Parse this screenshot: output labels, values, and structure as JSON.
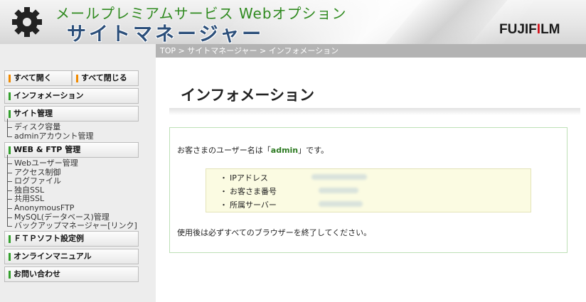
{
  "header": {
    "subtitle": "メールプレミアムサービス Webオプション",
    "title": "サイトマネージャー",
    "brand_main": "FUJIFILM",
    "brand_dot": "I"
  },
  "breadcrumb": [
    "TOP",
    "サイトマネージャー",
    "インフォメーション"
  ],
  "sidebar": {
    "expand_all": "すべて開く",
    "collapse_all": "すべて閉じる",
    "information": "インフォメーション",
    "site_admin": "サイト管理",
    "site_admin_items": [
      "ディスク容量",
      "adminアカウント管理"
    ],
    "web_ftp": "WEB & FTP 管理",
    "web_ftp_items": [
      "Webユーザー管理",
      "アクセス制御",
      "ログファイル",
      "独自SSL",
      "共用SSL",
      "AnonymousFTP",
      "MySQL(データベース)管理",
      "バックアップマネージャー[リンク]"
    ],
    "ftp_soft": "ＦＴＰソフト設定例",
    "manual": "オンラインマニュアル",
    "contact": "お問い合わせ"
  },
  "main": {
    "title": "インフォメーション",
    "welcome_prefix": "お客さまのユーザー名は「",
    "username": "admin",
    "welcome_suffix": "」です。",
    "info_labels": [
      "IPアドレス",
      "お客さま番号",
      "所属サーバー"
    ],
    "notice": "使用後は必ずすべてのブラウザーを終了してください。"
  },
  "colors": {
    "accent_green": "#33a02c",
    "accent_orange": "#f08a00",
    "brand_red": "#d3101a",
    "title_blue": "#2c4f7a"
  }
}
